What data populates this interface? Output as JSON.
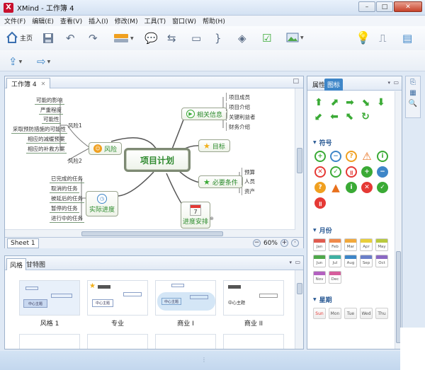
{
  "window": {
    "app_logo": "X",
    "title": "XMind - 工作簿 4",
    "min": "–",
    "max": "□",
    "close": "✕"
  },
  "menu": [
    "文件(F)",
    "编辑(E)",
    "查看(V)",
    "插入(I)",
    "修改(M)",
    "工具(T)",
    "窗口(W)",
    "帮助(H)"
  ],
  "toolbar": {
    "home_label": "主页"
  },
  "editor": {
    "tab_label": "工作簿 4",
    "tab_close": "✕",
    "sheet_tab": "Sheet 1",
    "zoom": "60%"
  },
  "mindmap": {
    "central": "项目计划",
    "topics": {
      "risk": "风险",
      "related": "相关信息",
      "goal": "目标",
      "conditions": "必要条件",
      "progress": "实际进度",
      "schedule": "进度安排",
      "schedule_day": "7"
    },
    "risk_labels": {
      "risk1": "风险1",
      "risk2": "风险2"
    },
    "risk1_items": [
      "可能的影响",
      "严重程度",
      "可能性",
      "采取预防措施的可能性",
      "相应的减缓预案",
      "相应的补救方案"
    ],
    "related_items": [
      "项目成员",
      "项目介绍",
      "关键利益者",
      "财务介绍"
    ],
    "conditions_items": [
      "预算",
      "人员",
      "资产"
    ],
    "progress_items": [
      "已完成的任务",
      "取消的任务",
      "被延后的任务",
      "暂停的任务",
      "进行中的任务"
    ]
  },
  "right_panel": {
    "tab_properties": "属性",
    "tab_icons": "图标",
    "section_symbols": "符号",
    "section_month": "月份",
    "section_week": "星期",
    "months": [
      "Jan",
      "Feb",
      "Mar",
      "Apr",
      "May",
      "Jun",
      "Jul",
      "Aug",
      "Sep",
      "Oct",
      "Nov",
      "Dec"
    ],
    "weekdays": [
      "Sun",
      "Mon",
      "Tue",
      "Wed",
      "Thu"
    ]
  },
  "style_panel": {
    "tab_style": "风格",
    "tab_gantt": "甘特图",
    "styles": [
      "风格 1",
      "专业",
      "商业 I",
      "商业 II"
    ],
    "card_center_label": "中心主题",
    "card_branch_label": "分支主题"
  },
  "colors": {
    "accent": "#3e86c8",
    "green": "#3aaa35",
    "orange": "#f0a020",
    "red": "#e53935",
    "months": [
      "#e05b4f",
      "#f08a4b",
      "#f2a93b",
      "#e9cf3a",
      "#b8c93d",
      "#4fa84a",
      "#3fb0a3",
      "#3e86c8",
      "#6a7fc9",
      "#8b68c3",
      "#b361c0",
      "#d65e9c"
    ]
  }
}
